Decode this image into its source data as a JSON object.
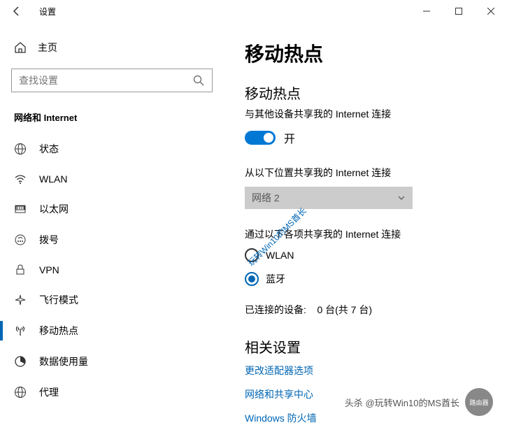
{
  "titlebar": {
    "app_title": "设置"
  },
  "sidebar": {
    "home_label": "主页",
    "search_placeholder": "查找设置",
    "category": "网络和 Internet",
    "items": [
      {
        "label": "状态"
      },
      {
        "label": "WLAN"
      },
      {
        "label": "以太网"
      },
      {
        "label": "拨号"
      },
      {
        "label": "VPN"
      },
      {
        "label": "飞行模式"
      },
      {
        "label": "移动热点"
      },
      {
        "label": "数据使用量"
      },
      {
        "label": "代理"
      }
    ]
  },
  "content": {
    "page_title": "移动热点",
    "hotspot_section_title": "移动热点",
    "hotspot_desc": "与其他设备共享我的 Internet 连接",
    "toggle_label": "开",
    "share_from_label": "从以下位置共享我的 Internet 连接",
    "share_from_value": "网络 2",
    "share_via_label": "通过以下各项共享我的 Internet 连接",
    "radio_wlan": "WLAN",
    "radio_bt": "蓝牙",
    "devices_label": "已连接的设备:",
    "devices_value": "0 台(共 7 台)",
    "related_title": "相关设置",
    "link1": "更改适配器选项",
    "link2": "网络和共享中心",
    "link3": "Windows 防火墙"
  },
  "watermark": "玩转Win10的MS酋长",
  "footer": {
    "text": "头杀 @玩转Win10的MS酋长",
    "logo": "路由器"
  }
}
